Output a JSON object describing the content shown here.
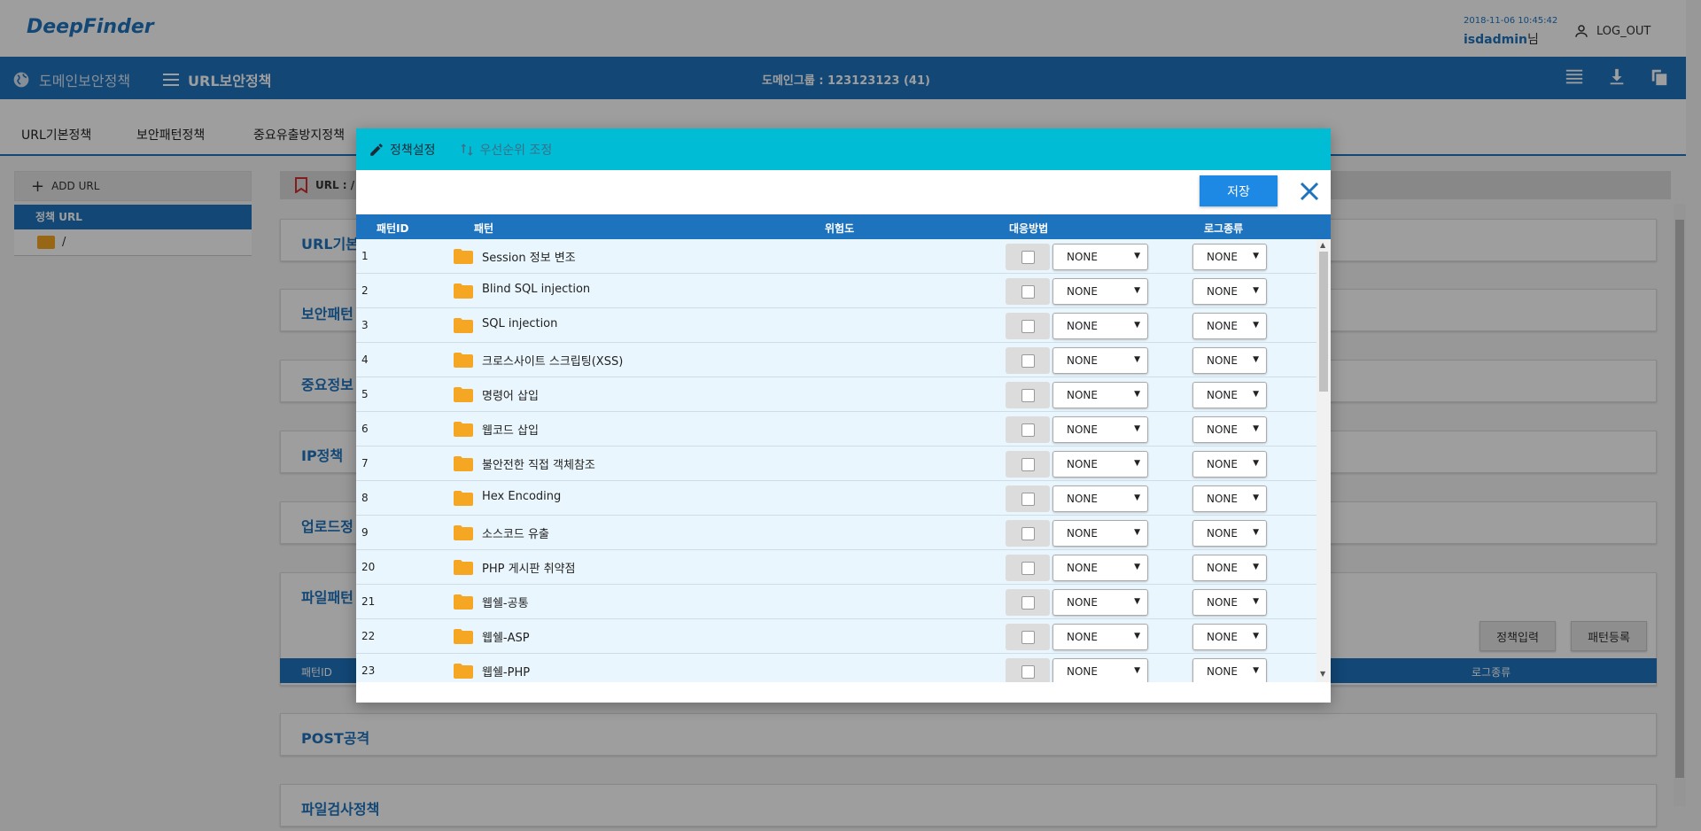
{
  "app": {
    "logo": "DeepFinder",
    "datetime": "2018-11-06 10:45:42",
    "user": "isdadmin",
    "user_suffix": "님",
    "logout": "LOG_OUT"
  },
  "nav": {
    "domain_policy": "도메인보안정책",
    "url_policy": "URL보안정책",
    "domain_group": "도메인그룹 : 123123123 (41)"
  },
  "tabs": [
    "URL기본정책",
    "보안패턴정책",
    "중요유출방지정책"
  ],
  "sidebar": {
    "add_url": "ADD URL",
    "policy_url": "정책 URL",
    "root": "/"
  },
  "urlbar": {
    "label": "URL : /"
  },
  "panels": [
    {
      "title": "URL기본"
    },
    {
      "title": "보안패턴"
    },
    {
      "title": "중요정보"
    },
    {
      "title": "IP정책"
    },
    {
      "title": "업로드정"
    },
    {
      "title": "파일패턴"
    },
    {
      "title": "POST공격"
    },
    {
      "title": "파일검사정책"
    }
  ],
  "file_pattern": {
    "btn_policy_input": "정책입력",
    "btn_pattern_register": "패턴등록",
    "col_id": "패턴ID",
    "col_log": "로그종류"
  },
  "modal": {
    "tab_policy": "정책설정",
    "tab_priority": "우선순위 조정",
    "save": "저장",
    "columns": {
      "id": "패턴ID",
      "pattern": "패턴",
      "risk": "위험도",
      "action": "대응방법",
      "log": "로그종류"
    },
    "rows": [
      {
        "id": "1",
        "name": "Session 정보 변조",
        "action": "NONE",
        "log": "NONE"
      },
      {
        "id": "2",
        "name": "Blind SQL injection",
        "action": "NONE",
        "log": "NONE"
      },
      {
        "id": "3",
        "name": "SQL injection",
        "action": "NONE",
        "log": "NONE"
      },
      {
        "id": "4",
        "name": "크로스사이트 스크립팅(XSS)",
        "action": "NONE",
        "log": "NONE"
      },
      {
        "id": "5",
        "name": "명령어 삽입",
        "action": "NONE",
        "log": "NONE"
      },
      {
        "id": "6",
        "name": "웹코드 삽입",
        "action": "NONE",
        "log": "NONE"
      },
      {
        "id": "7",
        "name": "불안전한 직접 객체참조",
        "action": "NONE",
        "log": "NONE"
      },
      {
        "id": "8",
        "name": "Hex Encoding",
        "action": "NONE",
        "log": "NONE"
      },
      {
        "id": "9",
        "name": "소스코드 유출",
        "action": "NONE",
        "log": "NONE"
      },
      {
        "id": "20",
        "name": "PHP 게시판 취약점",
        "action": "NONE",
        "log": "NONE"
      },
      {
        "id": "21",
        "name": "웹쉘-공통",
        "action": "NONE",
        "log": "NONE"
      },
      {
        "id": "22",
        "name": "웹쉘-ASP",
        "action": "NONE",
        "log": "NONE"
      },
      {
        "id": "23",
        "name": "웹쉘-PHP",
        "action": "NONE",
        "log": "NONE"
      }
    ]
  },
  "colors": {
    "primary": "#1e73be",
    "modal_header": "#00bcd4",
    "save_button": "#1e88e5",
    "folder": "#f5a623",
    "row_bg": "#eaf6fd"
  }
}
